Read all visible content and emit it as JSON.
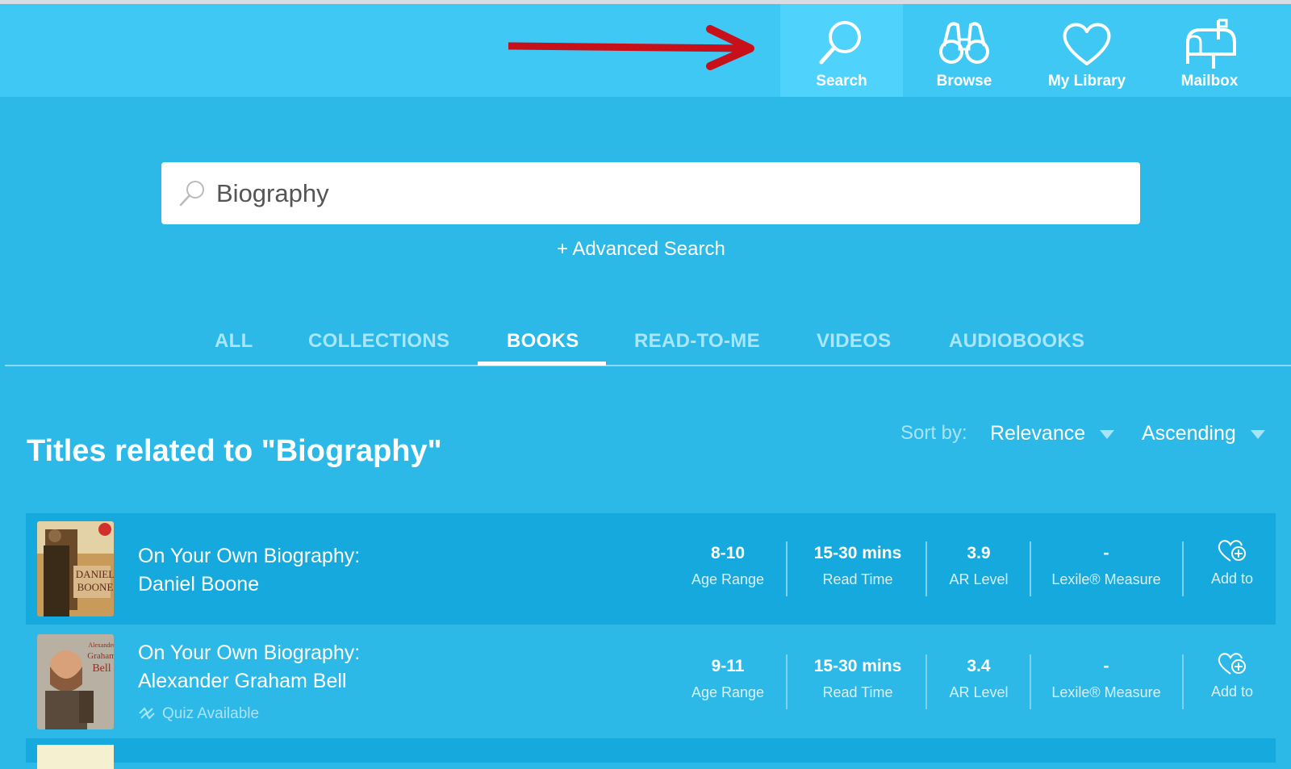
{
  "nav": {
    "search": "Search",
    "browse": "Browse",
    "library": "My Library",
    "mailbox": "Mailbox"
  },
  "search": {
    "value": "Biography"
  },
  "advanced_search": "+ Advanced Search",
  "tabs": [
    "ALL",
    "COLLECTIONS",
    "BOOKS",
    "READ-TO-ME",
    "VIDEOS",
    "AUDIOBOOKS"
  ],
  "active_tab": "BOOKS",
  "results_title": "Titles related to \"Biography\"",
  "sort": {
    "label": "Sort by:",
    "field": "Relevance",
    "order": "Ascending"
  },
  "books": [
    {
      "title_line1": "On Your Own Biography:",
      "title_line2": "Daniel Boone",
      "age_range": "8-10",
      "age_label": "Age Range",
      "read_time": "15-30 mins",
      "read_label": "Read Time",
      "ar_level": "3.9",
      "ar_label": "AR Level",
      "lexile": "-",
      "lexile_label": "Lexile® Measure",
      "add_label": "Add to"
    },
    {
      "title_line1": "On Your Own Biography:",
      "title_line2": "Alexander Graham Bell",
      "quiz": "Quiz Available",
      "age_range": "9-11",
      "age_label": "Age Range",
      "read_time": "15-30 mins",
      "read_label": "Read Time",
      "ar_level": "3.4",
      "ar_label": "AR Level",
      "lexile": "-",
      "lexile_label": "Lexile® Measure",
      "add_label": "Add to"
    }
  ],
  "colors": {
    "header": "#3fc8f4",
    "page": "#2cb9e8",
    "row_highlight": "#15a9de",
    "annotation_arrow": "#c8101a"
  }
}
